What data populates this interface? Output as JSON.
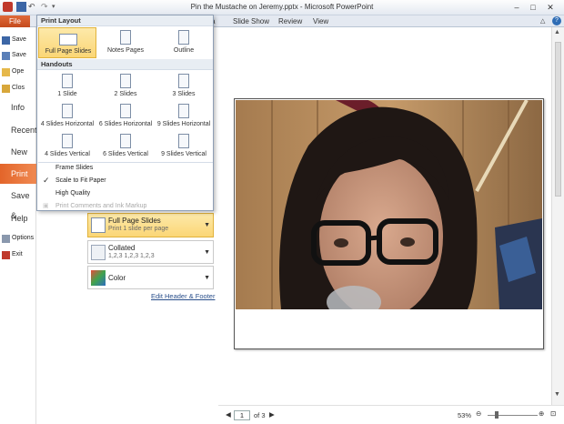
{
  "window": {
    "title": "Pin the Mustache on Jeremy.pptx - Microsoft PowerPoint"
  },
  "ribbon": {
    "file_tab": "File",
    "tabs": [
      "Slide Show",
      "Review",
      "View"
    ],
    "help": "?"
  },
  "backstage": {
    "commands": [
      {
        "label": "Save"
      },
      {
        "label": "Save"
      },
      {
        "label": "Ope"
      },
      {
        "label": "Clos"
      }
    ],
    "sections": [
      {
        "label": "Info"
      },
      {
        "label": "Recent"
      },
      {
        "label": "New"
      },
      {
        "label": "Print"
      },
      {
        "label": "Save &"
      },
      {
        "label": "Help"
      }
    ],
    "bottom": [
      {
        "label": "Options"
      },
      {
        "label": "Exit"
      }
    ]
  },
  "dropdown": {
    "print_layout_header": "Print Layout",
    "print_layouts": [
      {
        "label": "Full Page Slides"
      },
      {
        "label": "Notes Pages"
      },
      {
        "label": "Outline"
      }
    ],
    "handouts_header": "Handouts",
    "handouts": [
      {
        "label": "1 Slide"
      },
      {
        "label": "2 Slides"
      },
      {
        "label": "3 Slides"
      },
      {
        "label": "4 Slides Horizontal"
      },
      {
        "label": "6 Slides Horizontal"
      },
      {
        "label": "9 Slides Horizontal"
      },
      {
        "label": "4 Slides Vertical"
      },
      {
        "label": "6 Slides Vertical"
      },
      {
        "label": "9 Slides Vertical"
      }
    ],
    "options": [
      {
        "label": "Frame Slides",
        "checked": false,
        "enabled": true
      },
      {
        "label": "Scale to Fit Paper",
        "checked": true,
        "enabled": true
      },
      {
        "label": "High Quality",
        "checked": false,
        "enabled": true
      },
      {
        "label": "Print Comments and Ink Markup",
        "checked": false,
        "enabled": false
      }
    ]
  },
  "settings": {
    "layout": {
      "title": "Full Page Slides",
      "subtitle": "Print 1 slide per page"
    },
    "collation": {
      "title": "Collated",
      "subtitle": "1,2,3    1,2,3    1,2,3"
    },
    "color": {
      "title": "Color"
    },
    "edit_header_footer": "Edit Header & Footer"
  },
  "statusbar": {
    "page_current": "1",
    "page_total": "of 3",
    "zoom": "53%"
  },
  "colors": {
    "file_tab": "#d4572a",
    "selection": "#fbd676",
    "print_selected": "#e3652a"
  }
}
